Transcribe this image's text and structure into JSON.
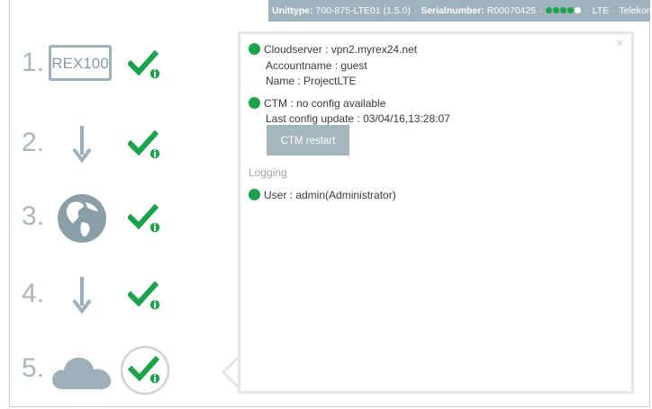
{
  "topbar": {
    "unittype_label": "Unittype:",
    "unittype_value": "700-875-LTE01 (1.5.0)",
    "serial_label": "Serialnumber:",
    "serial_value": "R00070425",
    "signal_strength": "4/5",
    "network_type": "LTE",
    "provider": "Telekom.de"
  },
  "steps": [
    {
      "number": "1.",
      "icon": "device-box",
      "device_label": "REX100",
      "status": "check-icon"
    },
    {
      "number": "2.",
      "icon": "down-arrow-icon",
      "status": "check-icon"
    },
    {
      "number": "3.",
      "icon": "globe-icon",
      "status": "check-icon"
    },
    {
      "number": "4.",
      "icon": "down-arrow-icon",
      "status": "check-icon"
    },
    {
      "number": "5.",
      "icon": "cloud-icon",
      "status": "check-icon-selected"
    }
  ],
  "panel": {
    "close_label": "×",
    "cloud_server": "Cloudserver : vpn2.myrex24.net",
    "account_name": "Accountname : guest",
    "name": "Name : ProjectLTE",
    "ctm_status": "CTM : no config available",
    "last_config": "Last config update : 03/04/16,13:28:07",
    "ctm_restart_label": "CTM restart",
    "logging_heading": "Logging",
    "user": "User : admin(Administrator)"
  },
  "colors": {
    "accent_green": "#1aa34a",
    "muted_blue_gray": "#9fb3bd",
    "step_number": "#a9b6bd"
  }
}
